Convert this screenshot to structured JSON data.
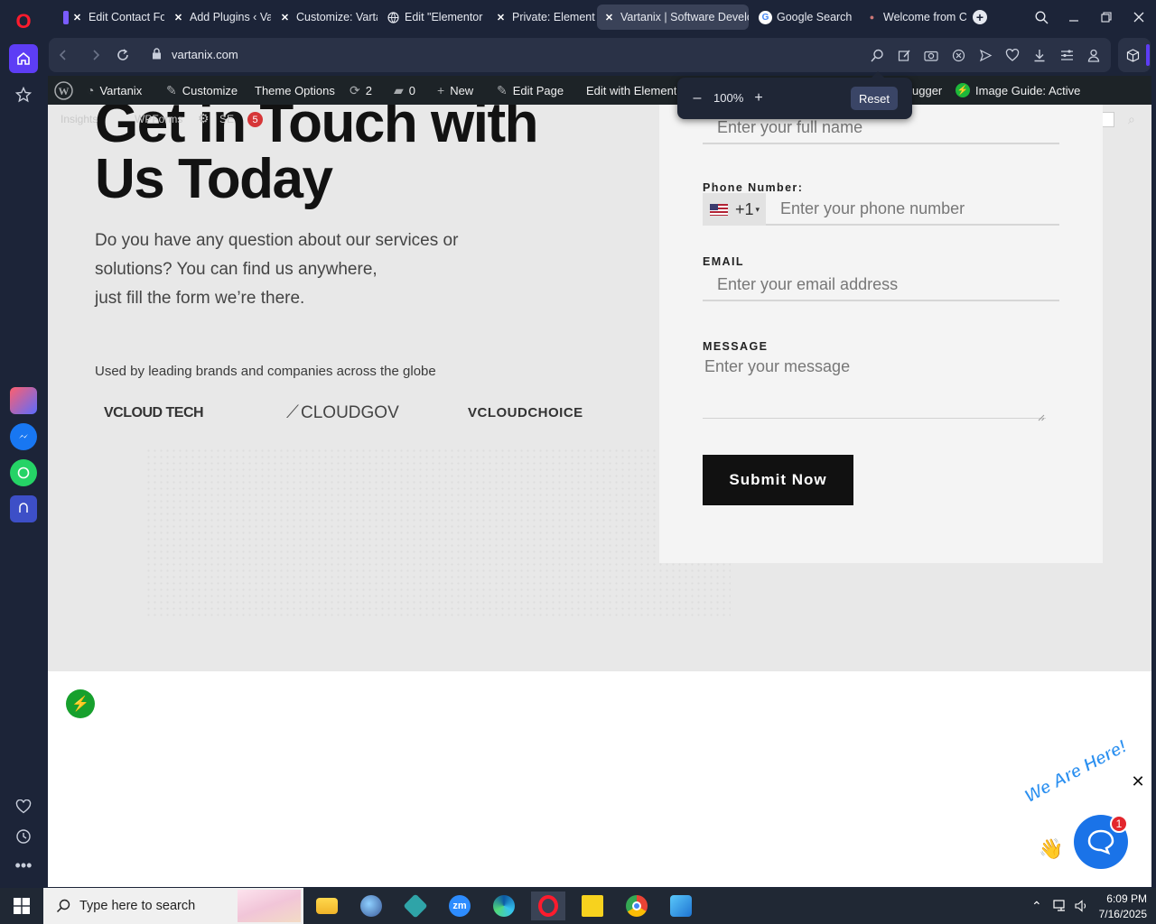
{
  "browser": {
    "tabs": [
      {
        "label": "Edit Contact Forn",
        "icon": "elementor-x-icon",
        "color": "#7a5cff"
      },
      {
        "label": "Add Plugins ‹ Var",
        "icon": "x-icon"
      },
      {
        "label": "Customize: Varta",
        "icon": "x-icon"
      },
      {
        "label": "Edit \"Elementor F",
        "icon": "globe-icon"
      },
      {
        "label": "Private: Elemento",
        "icon": "x-icon"
      },
      {
        "label": "Vartanix | Software Develo",
        "icon": "x-icon",
        "active": true
      },
      {
        "label": "Google Search",
        "icon": "google-icon"
      },
      {
        "label": "Welcome from C",
        "icon": "page-icon"
      }
    ],
    "url": "vartanix.com",
    "accent": "#5d3df5"
  },
  "wp_admin_bar": {
    "site": "Vartanix",
    "customize": "Customize",
    "theme_options": "Theme Options",
    "updates": "2",
    "comments": "0",
    "new": "New",
    "edit_page": "Edit Page",
    "edit_with": "Edit with Elemento",
    "debugger": "ugger",
    "image_guide": "Image Guide: Active"
  },
  "underlay_bar": {
    "insights": "Insights",
    "wpforms": "WPForms",
    "seo": "SE",
    "seo_count": "5"
  },
  "zoom_popup": {
    "minus": "–",
    "value": "100%",
    "plus": "+",
    "reset": "Reset"
  },
  "page": {
    "heading_line1": "Get in Touch with",
    "heading_line2": "Us Today",
    "subtext_line1": "Do you have any question about our services or",
    "subtext_line2": "solutions? You can find us anywhere,",
    "subtext_line3": "just fill the form we’re there.",
    "brands_caption": "Used by leading brands and companies across the globe",
    "brands": [
      "VCLOUD TECH",
      "CLOUDGOV",
      "VCLOUDCHOICE"
    ]
  },
  "form": {
    "name_placeholder": "Enter your full name",
    "phone_label": "Phone Number:",
    "phone_code": "+1",
    "phone_placeholder": "Enter your phone number",
    "email_label": "EMAIL",
    "email_placeholder": "Enter your email address",
    "message_label": "MESSAGE",
    "message_placeholder": "Enter your message",
    "submit_label": "Submit Now"
  },
  "chat_widget": {
    "banner": "We Are Here!",
    "badge": "1",
    "close": "✕"
  },
  "taskbar": {
    "search_placeholder": "Type here to search",
    "time": "6:09 PM",
    "date": "7/16/2025"
  }
}
